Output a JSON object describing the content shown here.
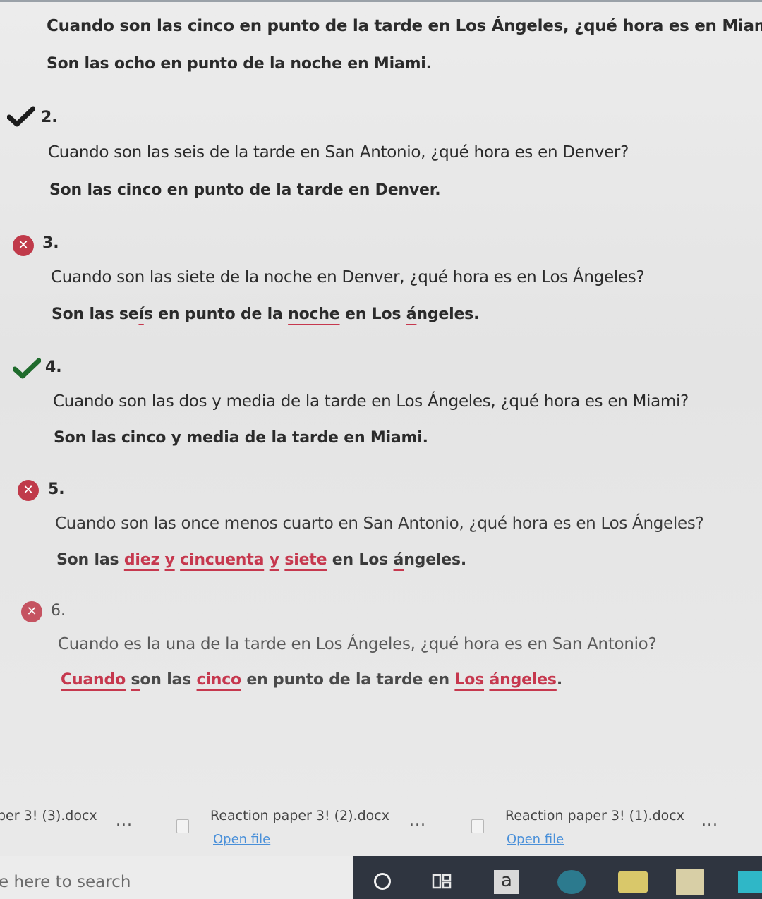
{
  "questions": [
    {
      "text": "Cuando son las cinco en punto de la tarde en Los Ángeles, ¿qué hora es en Miami?",
      "answer": "Son las ocho en punto de la noche en Miami."
    },
    {
      "number": "2.",
      "status": "correct",
      "text": "Cuando son las seis de la tarde en San Antonio, ¿qué hora es en Denver?",
      "answer": "Son las cinco en punto de la tarde en Denver."
    },
    {
      "number": "3.",
      "status": "incorrect",
      "text": "Cuando son las siete de la noche en Denver, ¿qué hora es en Los Ángeles?",
      "answer_parts": [
        "Son las se",
        "í",
        "s en punto de la ",
        "noche",
        " en Los ",
        "á",
        "ngeles."
      ]
    },
    {
      "number": "4.",
      "status": "correct",
      "text": "Cuando son las dos y media de la tarde en Los Ángeles, ¿qué hora es en Miami?",
      "answer": "Son las cinco y media de la tarde en Miami."
    },
    {
      "number": "5.",
      "status": "incorrect",
      "text": "Cuando son las once menos cuarto en San Antonio, ¿qué hora es en Los Ángeles?",
      "answer_parts": [
        "Son las ",
        "diez",
        " ",
        "y",
        " ",
        "cincuenta",
        " ",
        "y",
        " ",
        "siete",
        " en Los ",
        "á",
        "ngeles."
      ]
    },
    {
      "number": "6.",
      "status": "incorrect",
      "text": "Cuando es la una de la tarde en Los Ángeles, ¿qué hora es en San Antonio?",
      "answer_parts": [
        "Cuando",
        " ",
        "s",
        "on las ",
        "cinco",
        " en punto de la tarde en ",
        "Los",
        " ",
        "ángeles",
        "."
      ]
    }
  ],
  "icons": {
    "correct": "check-icon",
    "incorrect": "x-circle-icon"
  },
  "colors": {
    "error": "#c6384e",
    "check": "#1f6b2c",
    "x_badge": "#c03a4a",
    "link": "#4a90d9"
  },
  "downloads": [
    {
      "name": "per 3! (3).docx"
    },
    {
      "name": "Reaction paper 3! (2).docx",
      "action": "Open file"
    },
    {
      "name": "Reaction paper 3! (1).docx",
      "action": "Open file"
    }
  ],
  "downloads_more": "...",
  "taskbar": {
    "search_placeholder": "e here to search",
    "amazon_glyph": "a"
  }
}
